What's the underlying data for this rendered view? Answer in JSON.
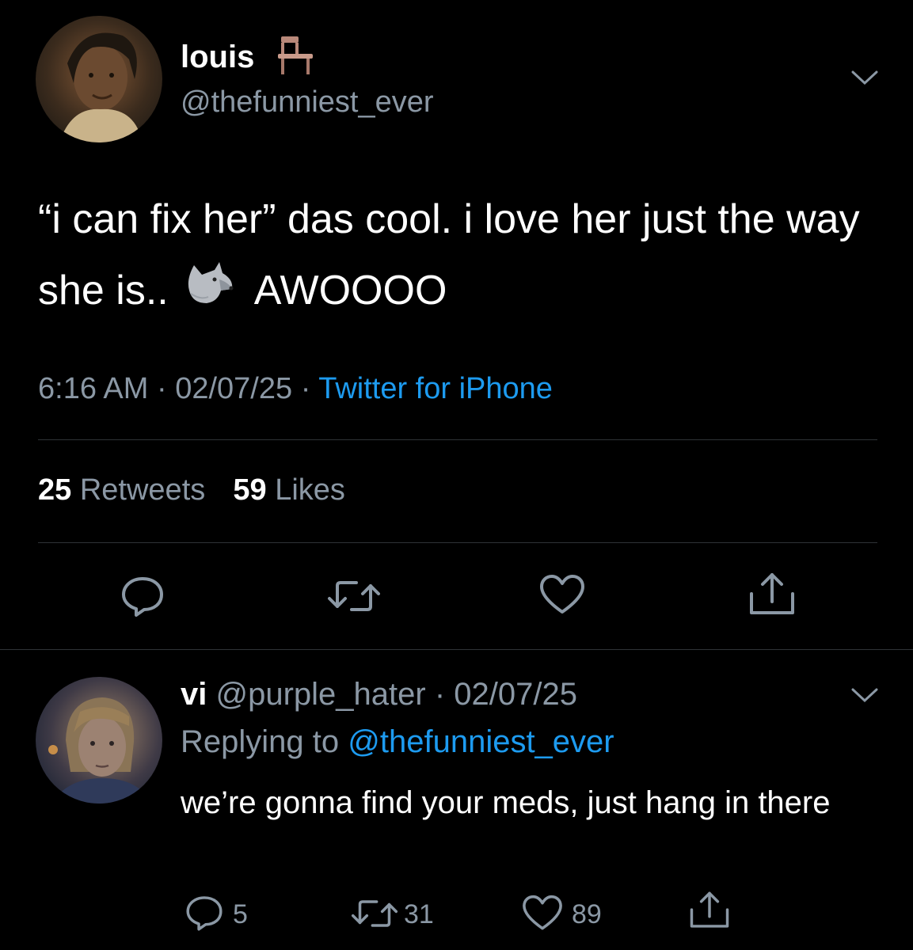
{
  "tweet": {
    "display_name": "louis",
    "handle": "@thefunniest_ever",
    "text_part1": "“i can fix her” das cool. i love her just the way she is..",
    "text_part2": "AWOOOO",
    "time": "6:16 AM",
    "date": "02/07/25",
    "source": "Twitter for iPhone",
    "retweet_count": "25",
    "retweet_label": "Retweets",
    "like_count": "59",
    "like_label": "Likes"
  },
  "reply": {
    "display_name": "vi",
    "handle": "@purple_hater",
    "date": "02/07/25",
    "replying_label": "Replying to",
    "replying_to": "@thefunniest_ever",
    "text": "we’re gonna find your meds, just hang in there",
    "reply_count": "5",
    "retweet_count": "31",
    "like_count": "89"
  },
  "icons": {
    "chair": "chair-icon",
    "wolf": "wolf-icon"
  },
  "colors": {
    "background": "#000000",
    "secondary_text": "#8b98a5",
    "link": "#1d9bf0",
    "divider": "#2f3336"
  }
}
